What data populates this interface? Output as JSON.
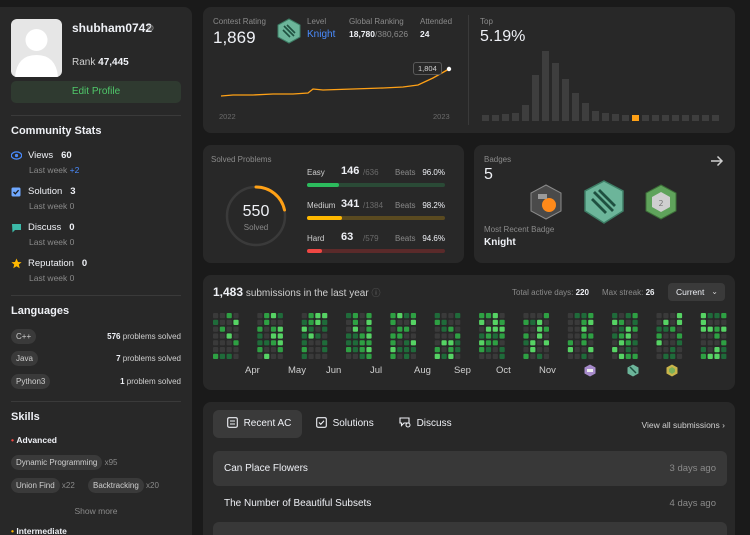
{
  "profile": {
    "username": "shubham0742",
    "rank_label": "Rank",
    "rank_value": "47,445",
    "edit_label": "Edit Profile"
  },
  "community": {
    "title": "Community Stats",
    "items": [
      {
        "label": "Views",
        "value": "60",
        "sub": "Last week",
        "delta": "+2",
        "icon": "eye-icon",
        "color": "#4a8cff"
      },
      {
        "label": "Solution",
        "value": "3",
        "sub": "Last week",
        "delta": "0",
        "icon": "check-square-icon",
        "color": "#6fa8ff"
      },
      {
        "label": "Discuss",
        "value": "0",
        "sub": "Last week",
        "delta": "0",
        "icon": "chat-icon",
        "color": "#3cb9a8"
      },
      {
        "label": "Reputation",
        "value": "0",
        "sub": "Last week",
        "delta": "0",
        "icon": "star-icon",
        "color": "#ffb800"
      }
    ]
  },
  "languages": {
    "title": "Languages",
    "items": [
      {
        "name": "C++",
        "count": "576",
        "suffix": "problems solved"
      },
      {
        "name": "Java",
        "count": "7",
        "suffix": "problems solved"
      },
      {
        "name": "Python3",
        "count": "1",
        "suffix": "problem solved"
      }
    ]
  },
  "skills": {
    "title": "Skills",
    "advanced_label": "Advanced",
    "tags": [
      {
        "name": "Dynamic Programming",
        "count": "x95"
      },
      {
        "name": "Union Find",
        "count": "x22"
      },
      {
        "name": "Backtracking",
        "count": "x20"
      }
    ],
    "show_more": "Show more",
    "intermediate_label": "Intermediate"
  },
  "contest": {
    "rating_label": "Contest Rating",
    "rating_value": "1,869",
    "level_label": "Level",
    "level_value": "Knight",
    "global_label": "Global Ranking",
    "global_value": "18,780",
    "global_total": "/380,626",
    "attended_label": "Attended",
    "attended_value": "24",
    "tooltip": "1,804",
    "year_start": "2022",
    "year_end": "2023",
    "top_label": "Top",
    "top_value": "5.19%"
  },
  "solved": {
    "title": "Solved Problems",
    "total": "550",
    "total_label": "Solved",
    "rows": [
      {
        "level": "Easy",
        "count": "146",
        "total": "/636",
        "beats_label": "Beats",
        "beats": "96.0%",
        "color": "#2cbb5d",
        "track": "#2a4a36",
        "fill": 0.23
      },
      {
        "level": "Medium",
        "count": "341",
        "total": "/1384",
        "beats_label": "Beats",
        "beats": "98.2%",
        "color": "#ffb800",
        "track": "#5a4a20",
        "fill": 0.25
      },
      {
        "level": "Hard",
        "count": "63",
        "total": "/579",
        "beats_label": "Beats",
        "beats": "94.6%",
        "color": "#ef4743",
        "track": "#5a2a2a",
        "fill": 0.11
      }
    ]
  },
  "badges": {
    "title": "Badges",
    "count": "5",
    "recent_label": "Most Recent Badge",
    "recent_value": "Knight"
  },
  "submissions": {
    "count": "1,483",
    "label": "submissions in the last year",
    "active_label": "Total active days:",
    "active_value": "220",
    "streak_label": "Max streak:",
    "streak_value": "26",
    "select_value": "Current",
    "months": [
      "Apr",
      "May",
      "Jun",
      "Jul",
      "Aug",
      "Sep",
      "Oct",
      "Nov"
    ]
  },
  "tabs": {
    "items": [
      {
        "label": "Recent AC",
        "icon": "list-icon"
      },
      {
        "label": "Solutions",
        "icon": "check-square-icon"
      },
      {
        "label": "Discuss",
        "icon": "discuss-icon"
      }
    ],
    "view_all": "View all submissions"
  },
  "recent": [
    {
      "title": "Can Place Flowers",
      "time": "3 days ago"
    },
    {
      "title": "The Number of Beautiful Subsets",
      "time": "4 days ago"
    }
  ]
}
